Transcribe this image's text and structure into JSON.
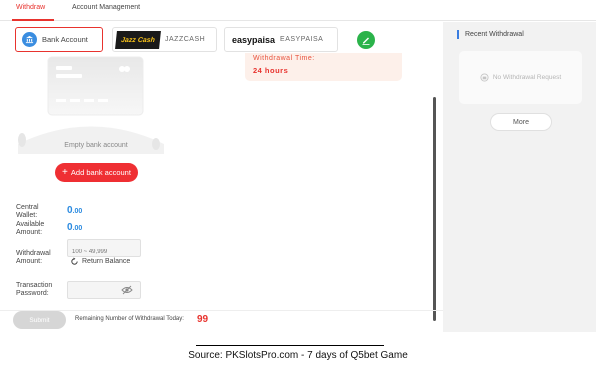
{
  "tabs": [
    {
      "label": "Withdraw",
      "active": true
    },
    {
      "label": "Account Management",
      "active": false
    }
  ],
  "methods": {
    "bank": {
      "label": "Bank Account",
      "selected": true
    },
    "jazzcash": {
      "logo_text": "Jazz Cash",
      "label": "JAZZCASH"
    },
    "easypaisa": {
      "logo_text": "easypaisa",
      "label": "EASYPAISA"
    },
    "edit_icon": "pencil-icon"
  },
  "notice": {
    "title": "Withdrawal Time:",
    "value": "24 hours"
  },
  "empty_state": {
    "label": "Empty bank account"
  },
  "add_bank_button": {
    "plus": "+",
    "label": "Add bank account"
  },
  "fields": {
    "central_wallet": {
      "label": "Central Wallet:",
      "value": "0",
      "decimals": ".00"
    },
    "available_amount": {
      "label": "Available Amount:",
      "value": "0",
      "decimals": ".00"
    },
    "withdrawal_amount": {
      "label": "Withdrawal Amount:",
      "placeholder": "100 ~ 49,999"
    },
    "return_balance": {
      "label": "Return Balance"
    },
    "transaction_password": {
      "label": "Transaction Password:",
      "placeholder": ""
    }
  },
  "footer": {
    "submit_label": "Submit",
    "remaining_label": "Remaining Number of Withdrawal Today:",
    "remaining_value": "99"
  },
  "recent": {
    "title": "Recent Withdrawal",
    "empty_label": "No Withdrawal Request",
    "more_label": "More"
  },
  "caption": "Source: PKSlotsPro.com - 7 days of Q5bet Game",
  "colors": {
    "accent": "#e8332e",
    "amount_blue": "#2a8ae0",
    "edit_green": "#2bb34a",
    "panel_gray": "#f2f2f2"
  }
}
